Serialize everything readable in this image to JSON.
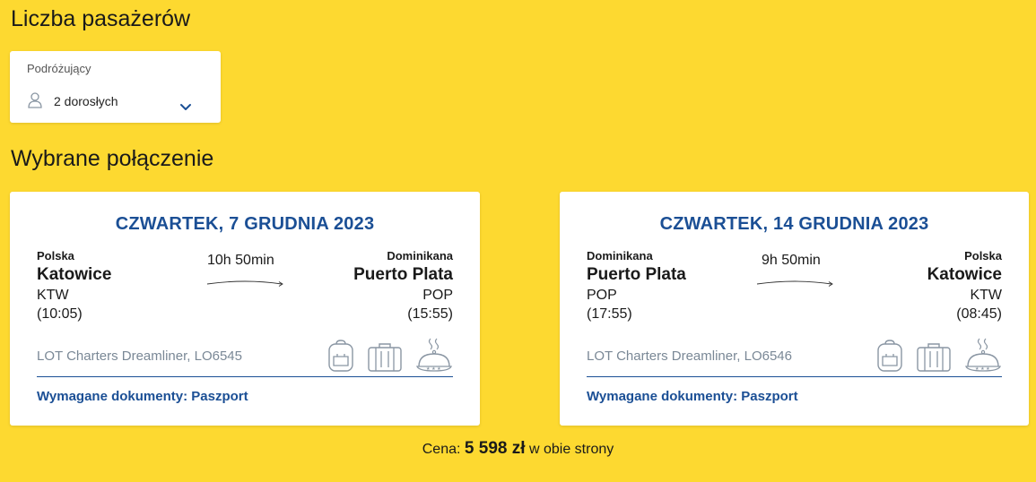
{
  "passengers": {
    "title": "Liczba pasażerów",
    "field_label": "Podróżujący",
    "value": "2 dorosłych"
  },
  "connection": {
    "title": "Wybrane połączenie",
    "outbound": {
      "date": "CZWARTEK, 7 GRUDNIA 2023",
      "origin": {
        "country": "Polska",
        "city": "Katowice",
        "code": "KTW",
        "time": "(10:05)"
      },
      "destination": {
        "country": "Dominikana",
        "city": "Puerto Plata",
        "code": "POP",
        "time": "(15:55)"
      },
      "duration": "10h 50min",
      "carrier": "LOT Charters Dreamliner, LO6545",
      "documents": "Wymagane dokumenty: Paszport"
    },
    "return": {
      "date": "CZWARTEK, 14 GRUDNIA 2023",
      "origin": {
        "country": "Dominikana",
        "city": "Puerto Plata",
        "code": "POP",
        "time": "(17:55)"
      },
      "destination": {
        "country": "Polska",
        "city": "Katowice",
        "code": "KTW",
        "time": "(08:45)"
      },
      "duration": "9h 50min",
      "carrier": "LOT Charters Dreamliner, LO6546",
      "documents": "Wymagane dokumenty: Paszport"
    }
  },
  "price": {
    "label": "Cena:",
    "amount": "5 598 zł",
    "suffix": "w obie strony"
  },
  "icons": {
    "amenities": [
      "backpack-icon",
      "suitcase-icon",
      "meal-cloche-icon"
    ]
  },
  "colors": {
    "background": "#fdd930",
    "accent": "#1b4f95",
    "muted": "#7a8896"
  }
}
